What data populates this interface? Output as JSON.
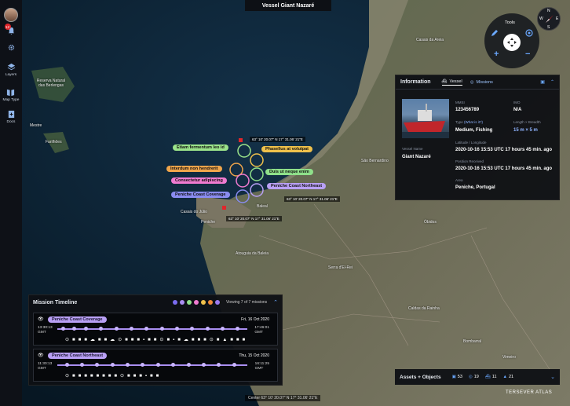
{
  "window": {
    "title": "Vessel Giant Nazaré"
  },
  "sidebar": {
    "badge_count": "12",
    "items": [
      {
        "label": "Layers",
        "icon": "layers-icon"
      },
      {
        "label": "Map Type",
        "icon": "book-map-icon"
      },
      {
        "label": "Docs",
        "icon": "docs-icon"
      }
    ]
  },
  "tools": {
    "label": "Tools"
  },
  "compass": {
    "n": "N",
    "s": "S",
    "e": "E",
    "w": "W"
  },
  "info": {
    "title": "Information",
    "tabs": [
      {
        "label": "Vessel"
      },
      {
        "label": "Missions"
      }
    ],
    "vessel_name_label": "Vessel Name",
    "vessel_name": "Giant Nazaré",
    "mmsi_label": "MMSI",
    "mmsi": "123456789",
    "imo_label": "IMO",
    "imo": "N/A",
    "type_label": "Type",
    "type_link": "(What is it?)",
    "type": "Medium, Fishing",
    "length_label": "Length × Breadth",
    "length": "15 m × 5 m",
    "latlon_label": "Latitude / Longitude",
    "latlon": "2020-10-16 15:53 UTC 17 hours 45 min. ago",
    "position_label": "Position Received",
    "position": "2020-10-16 15:53 UTC 17 hours 45 min. ago",
    "area_label": "Area",
    "area": "Peniche, Portugal"
  },
  "timeline": {
    "title": "Mission Timeline",
    "viewing": "Viewing 7 of 7 missions",
    "dot_colors": [
      "#7b6cf0",
      "#a98ef0",
      "#8fe08a",
      "#f07bd0",
      "#f0c14b",
      "#f08a3a",
      "#9b7bf0"
    ],
    "missions": [
      {
        "name": "Peniche Coast Coverage",
        "date": "Fri, 16 Oct 2020",
        "start": "13:30:13",
        "start_tz": "GMT",
        "end": "17:46:01",
        "end_tz": "GMT",
        "icons": "⊙■■■☁■■☁⊙■■■▪■■⊙■▪■☁■■■⊙■▲■■■"
      },
      {
        "name": "Peniche Coast Northeast",
        "date": "Thu, 15 Oct 2020",
        "start": "11:30:13",
        "start_tz": "GMT",
        "end": "16:11:25",
        "end_tz": "GMT",
        "icons": "⊙■■■■■■■■⊙■■■▪■■"
      }
    ]
  },
  "aois": [
    {
      "label": "Etiam fermentum leo id",
      "color": "#9be38a"
    },
    {
      "label": "Phasellus at volutpat",
      "color": "#f0c14b"
    },
    {
      "label": "Interdum non hendrerit",
      "color": "#f0a54b"
    },
    {
      "label": "Duis ut neque enim",
      "color": "#8fe08a"
    },
    {
      "label": "Consectetur adipiscing",
      "color": "#f07bd0"
    },
    {
      "label": "Peniche Coast Northeast",
      "color": "#b9a0f5"
    },
    {
      "label": "Peniche Coast Coverage",
      "color": "#8a8cf0"
    }
  ],
  "coords": {
    "c1": "63° 10' 20.07\" N 17° 31.06' 21\"E",
    "c2": "63° 10' 20.07\" N 17° 31.06' 21\"E",
    "c3": "63° 10' 20.07\" N 17° 31.06' 21\"E",
    "center": "Center 63° 10' 20.07\" N 17° 31.06' 21\"E"
  },
  "places": [
    "Reserva Natural das Berlengas",
    "Farilhões",
    "Mestre",
    "Baleal",
    "Peniche",
    "Casais do Júlio",
    "Atouguia da Baleia",
    "Óbidos",
    "Bombarral",
    "Serra d'El-Rei",
    "Caldas da Rainha",
    "Casais da Areia",
    "São Bernardino",
    "Vimeiro"
  ],
  "assets": {
    "title": "Assets + Objects",
    "c1": "53",
    "c2": "19",
    "c3": "11",
    "c4": "21"
  },
  "brand": "TERSEVER ATLAS"
}
